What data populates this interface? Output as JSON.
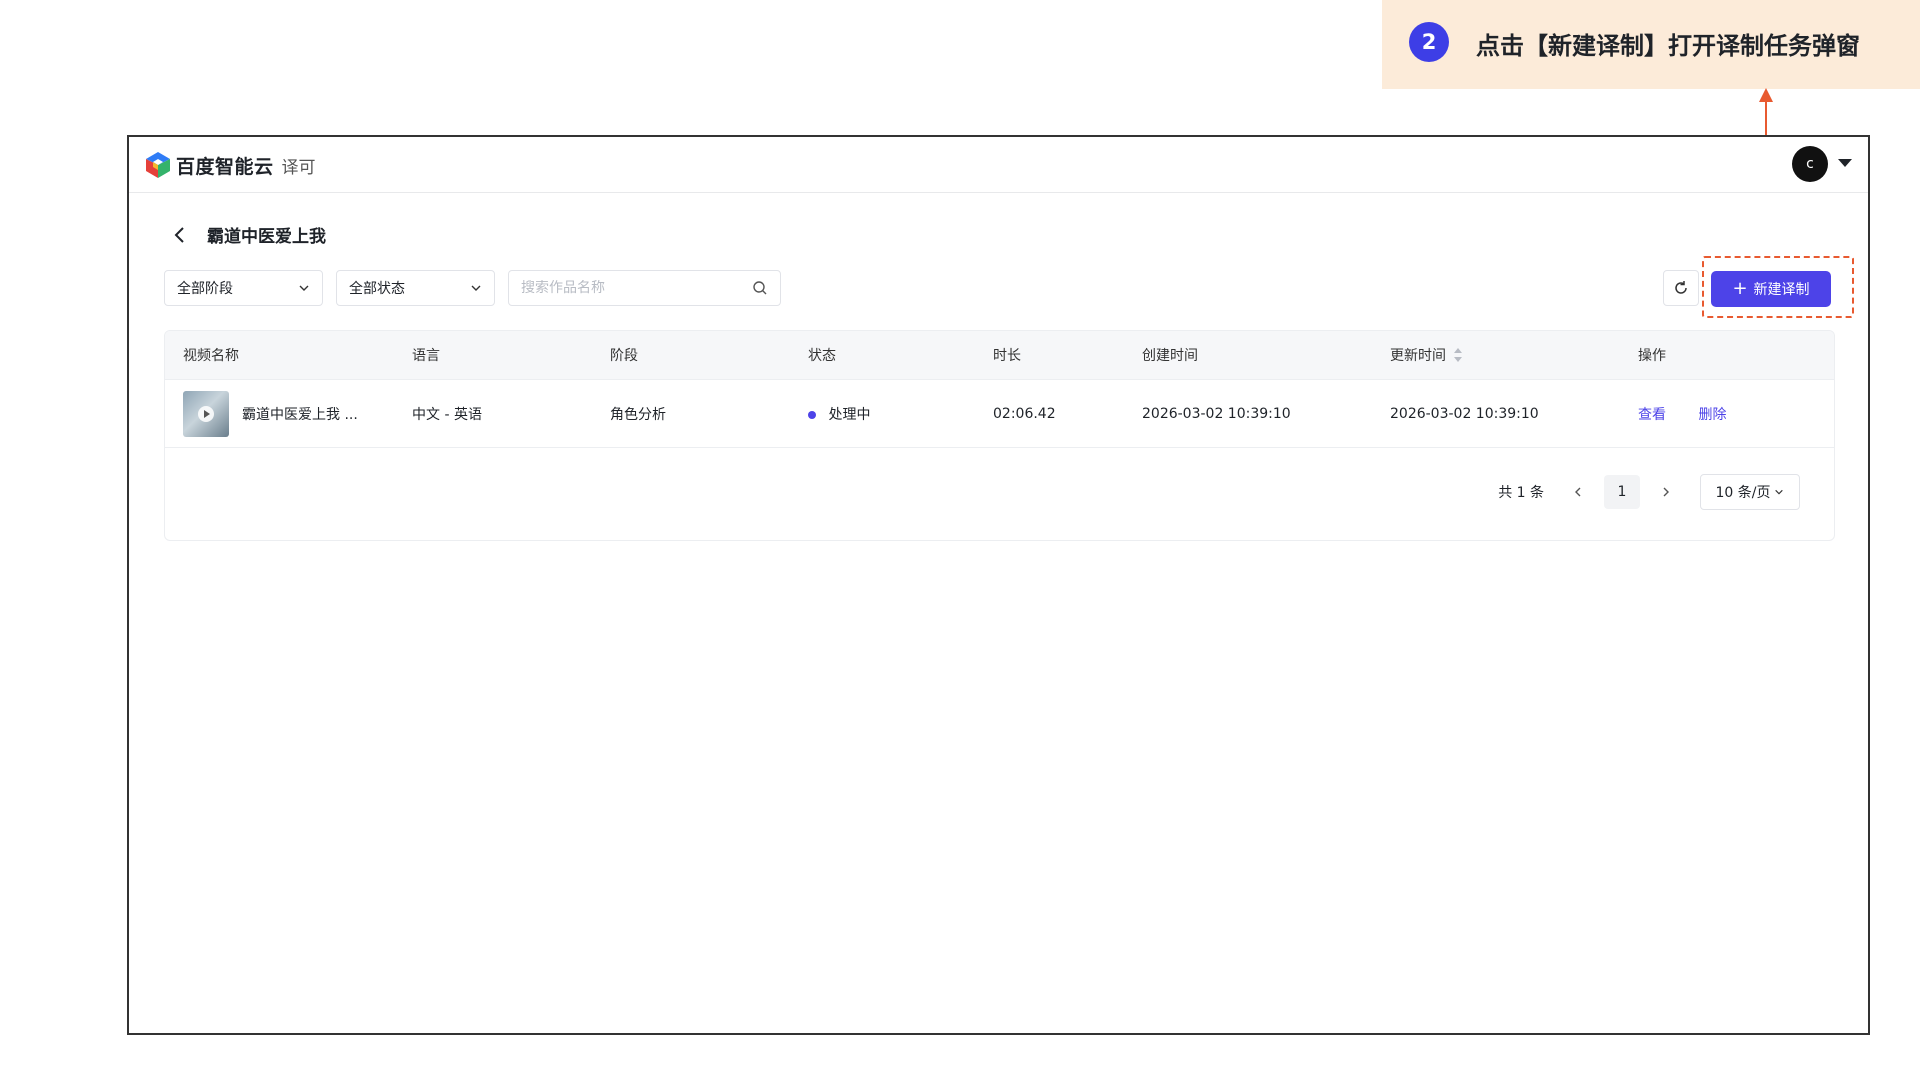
{
  "callout": {
    "step": "2",
    "text": "点击【新建译制】打开译制任务弹窗"
  },
  "header": {
    "brand": "百度智能云",
    "product": "译可",
    "avatar_letter": "c"
  },
  "page": {
    "title": "霸道中医爱上我"
  },
  "filters": {
    "stage": "全部阶段",
    "status": "全部状态",
    "search_placeholder": "搜索作品名称"
  },
  "actions": {
    "create_label": "新建译制",
    "create_icon": "plus-icon",
    "refresh_icon": "refresh-icon"
  },
  "table": {
    "headers": [
      "视频名称",
      "语言",
      "阶段",
      "状态",
      "时长",
      "创建时间",
      "更新时间",
      "操作"
    ],
    "rows": [
      {
        "name": "霸道中医爱上我 ...",
        "language": "中文 - 英语",
        "stage": "角色分析",
        "status": "处理中",
        "duration": "02:06.42",
        "created": "2026-03-02 10:39:10",
        "updated": "2026-03-02 10:39:10",
        "view_label": "查看",
        "delete_label": "删除"
      }
    ]
  },
  "pagination": {
    "total": "共 1 条",
    "current": "1",
    "page_size": "10 条/页"
  },
  "colors": {
    "accent": "#4d43e8",
    "annotation": "#e85a30",
    "callout_bg": "#fcebd9"
  }
}
